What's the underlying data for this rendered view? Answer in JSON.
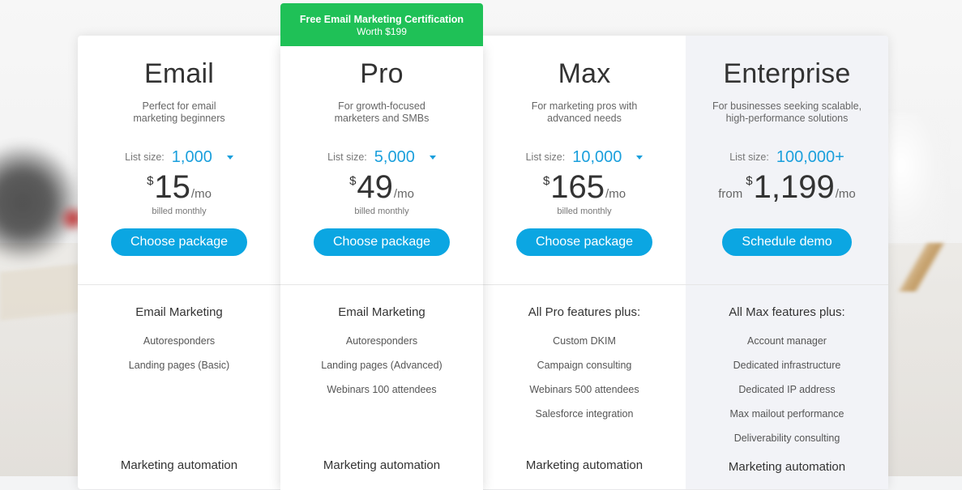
{
  "ribbon": {
    "line1": "Free Email Marketing Certification",
    "line2": "Worth $199"
  },
  "plans": [
    {
      "name": "Email",
      "desc1": "Perfect for email",
      "desc2": "marketing beginners",
      "list_label": "List size:",
      "list_value": "1,000",
      "from": "",
      "currency": "$",
      "amount": "15",
      "per": "/mo",
      "billed": "billed monthly",
      "button": "Choose package",
      "features_head": "Email Marketing",
      "features": [
        "Autoresponders",
        "Landing pages (Basic)"
      ],
      "section2": "Marketing automation"
    },
    {
      "name": "Pro",
      "desc1": "For growth-focused",
      "desc2": "marketers and SMBs",
      "list_label": "List size:",
      "list_value": "5,000",
      "from": "",
      "currency": "$",
      "amount": "49",
      "per": "/mo",
      "billed": "billed monthly",
      "button": "Choose package",
      "features_head": "Email Marketing",
      "features": [
        "Autoresponders",
        "Landing pages (Advanced)",
        "Webinars 100 attendees"
      ],
      "section2": "Marketing automation"
    },
    {
      "name": "Max",
      "desc1": "For marketing pros with",
      "desc2": "advanced needs",
      "list_label": "List size:",
      "list_value": "10,000",
      "from": "",
      "currency": "$",
      "amount": "165",
      "per": "/mo",
      "billed": "billed monthly",
      "button": "Choose package",
      "features_head": "All Pro features plus:",
      "features": [
        "Custom DKIM",
        "Campaign consulting",
        "Webinars 500 attendees",
        "Salesforce integration"
      ],
      "section2": "Marketing automation"
    },
    {
      "name": "Enterprise",
      "desc1": "For businesses seeking scalable,",
      "desc2": "high-performance solutions",
      "list_label": "List size:",
      "list_value": "100,000+",
      "from": "from",
      "currency": "$",
      "amount": "1,199",
      "per": "/mo",
      "billed": "",
      "button": "Schedule demo",
      "features_head": "All Max features plus:",
      "features": [
        "Account manager",
        "Dedicated infrastructure",
        "Dedicated IP address",
        "Max mailout performance",
        "Deliverability consulting"
      ],
      "section2": "Marketing automation"
    }
  ],
  "colors": {
    "accent": "#0ba6e2",
    "ribbon": "#1fc157",
    "enterprise_bg": "#f2f3f7"
  }
}
